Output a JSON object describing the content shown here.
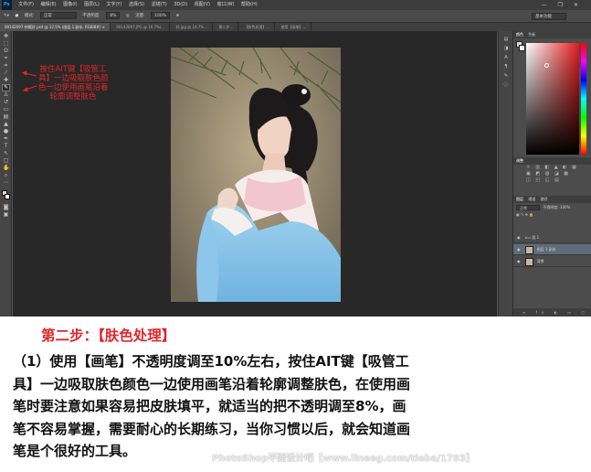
{
  "app": {
    "logo": "Ps",
    "menu": [
      "文件(F)",
      "编辑(E)",
      "图像(I)",
      "图层(L)",
      "文字(Y)",
      "选择(S)",
      "滤镜(T)",
      "3D(D)",
      "视图(V)",
      "窗口(W)",
      "帮助(H)"
    ],
    "window_buttons": "— ❐ ✕"
  },
  "options_bar": {
    "mode_label": "模式:",
    "mode_value": "正常",
    "opacity_label": "不透明度:",
    "opacity_value": "8%",
    "flow_label": "流量:",
    "flow_value": "100%",
    "workspace": "基本功能"
  },
  "tabs": [
    {
      "label": "00142097-帅帽好.psd @ 12.5% (图层 1 副本, RGB/8#) ×",
      "active": true
    },
    {
      "label": "90142097.JPG @ 16.7%(...",
      "active": false
    },
    {
      "label": "好.jpg @ 16.7%...",
      "active": false
    },
    {
      "label": "第二步...",
      "active": false
    },
    {
      "label": "【肤色处理】...",
      "active": false
    },
    {
      "label": "使用【画笔】...",
      "active": false
    }
  ],
  "annotation": {
    "lines": [
      "按住AIT键【吸管工",
      "具】一边吸取肤色颜",
      "色一边使用画笔沿着",
      "轮廓调整肤色"
    ],
    "color": "#e1252a"
  },
  "panels": {
    "color_tabs": [
      "颜色",
      "色板"
    ],
    "adjust_tab": "调整",
    "adjust_rows": [
      "☼ ▥ ◧ ▲ ◐ ▦",
      "▣ ◩ ▨ ◪ ▩",
      "◫ ◰ ◱ ▤"
    ],
    "layers_tabs": [
      "图层",
      "通道",
      "路径"
    ],
    "blend_mode": "正常",
    "layer_opacity": "不透明度: 100%",
    "layers": [
      {
        "name": "组 1",
        "active": false
      },
      {
        "name": "图层 1 副本",
        "active": true
      },
      {
        "name": "背景",
        "active": false
      }
    ]
  },
  "step": {
    "title": "第二步：【肤色处理】",
    "title_color": "#e0262a",
    "lines": [
      "（1）使用【画笔】不透明度调至10%左右，按住AIT键【吸管工",
      "具】一边吸取肤色颜色一边使用画笔沿着轮廓调整肤色，在使用画",
      "笔时要注意如果容易把皮肤填平，就适当的把不透明调至8%，画",
      "笔不容易掌握，需要耐心的长期练习，当你习惯以后，就会知道画",
      "笔是个很好的工具。"
    ]
  },
  "watermark": "PhotoShop平面设计吧【www.lineeg.com/tieba/1783】"
}
